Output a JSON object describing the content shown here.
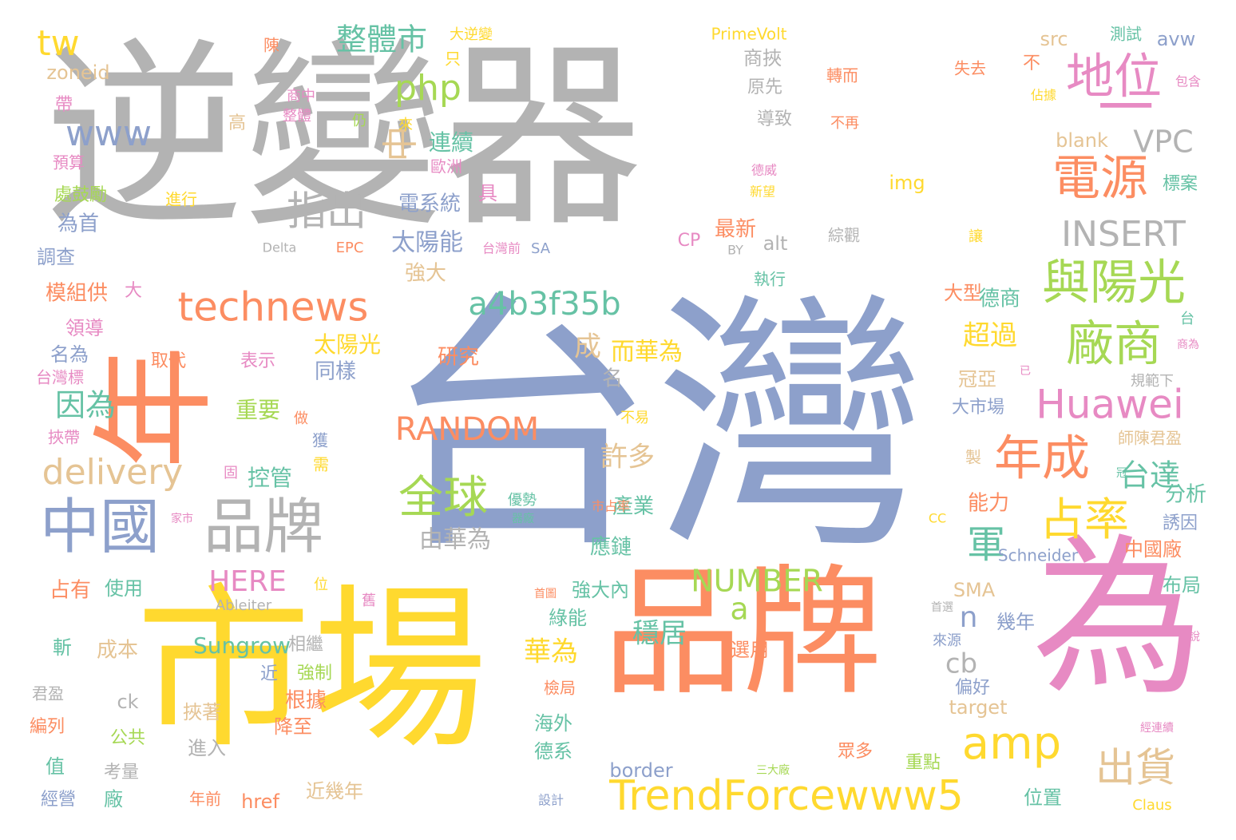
{
  "palette": {
    "gray": "#b3b3b3",
    "blue": "#8da0cb",
    "orange": "#fc8d62",
    "yellow": "#ffd92f",
    "pink": "#e78ac3",
    "green": "#a6d854",
    "teal": "#66c2a5",
    "tan": "#e5c494"
  },
  "words": [
    {
      "id": "w0",
      "text": "逆變器",
      "color": "gray"
    },
    {
      "id": "w1",
      "text": "台灣",
      "color": "blue"
    },
    {
      "id": "w2",
      "text": "市場",
      "color": "yellow"
    },
    {
      "id": "w3",
      "text": "品牌",
      "color": "orange"
    },
    {
      "id": "w4",
      "text": "為",
      "color": "pink"
    },
    {
      "id": "w5",
      "text": "年",
      "color": "orange"
    },
    {
      "id": "w6",
      "text": "一",
      "color": "pink"
    },
    {
      "id": "w7",
      "text": "中國",
      "color": "blue"
    },
    {
      "id": "w8",
      "text": "品牌",
      "color": "gray"
    },
    {
      "id": "w9",
      "text": "technews",
      "color": "orange"
    },
    {
      "id": "w10",
      "text": "TrendForcewww5",
      "color": "yellow"
    },
    {
      "id": "w11",
      "text": "Huawei",
      "color": "pink"
    },
    {
      "id": "w12",
      "text": "地位",
      "color": "pink"
    },
    {
      "id": "w13",
      "text": "廠商",
      "color": "green"
    },
    {
      "id": "w14",
      "text": "年成",
      "color": "orange"
    },
    {
      "id": "w15",
      "text": "電源",
      "color": "orange"
    },
    {
      "id": "w16",
      "text": "與陽光",
      "color": "green"
    },
    {
      "id": "w17",
      "text": "全球",
      "color": "green"
    },
    {
      "id": "w18",
      "text": "占率",
      "color": "yellow"
    },
    {
      "id": "w19",
      "text": "amp",
      "color": "yellow"
    },
    {
      "id": "w20",
      "text": "a4b3f35b",
      "color": "teal"
    },
    {
      "id": "w21",
      "text": "delivery",
      "color": "tan"
    },
    {
      "id": "w22",
      "text": "INSERT",
      "color": "gray"
    },
    {
      "id": "w23",
      "text": "RANDOM",
      "color": "orange"
    },
    {
      "id": "w24",
      "text": "NUMBER",
      "color": "green"
    },
    {
      "id": "w25",
      "text": "HERE",
      "color": "pink"
    },
    {
      "id": "w26",
      "text": "www",
      "color": "blue"
    },
    {
      "id": "w27",
      "text": "php",
      "color": "green"
    },
    {
      "id": "w28",
      "text": "tw",
      "color": "yellow"
    },
    {
      "id": "w29",
      "text": "整體市",
      "color": "teal"
    },
    {
      "id": "w30",
      "text": "指出",
      "color": "gray"
    },
    {
      "id": "w31",
      "text": "中",
      "color": "tan"
    },
    {
      "id": "w32",
      "text": "出貨",
      "color": "tan"
    },
    {
      "id": "w33",
      "text": "軍",
      "color": "teal"
    },
    {
      "id": "w34",
      "text": "台達",
      "color": "teal"
    },
    {
      "id": "w35",
      "text": "VPC",
      "color": "gray"
    },
    {
      "id": "w36",
      "text": "因為",
      "color": "teal"
    },
    {
      "id": "w37",
      "text": "a",
      "color": "green"
    },
    {
      "id": "w38",
      "text": "n",
      "color": "blue"
    },
    {
      "id": "w39",
      "text": "cb",
      "color": "gray"
    },
    {
      "id": "w40",
      "text": "超過",
      "color": "yellow"
    },
    {
      "id": "w41",
      "text": "穩居",
      "color": "teal"
    },
    {
      "id": "w42",
      "text": "華為",
      "color": "yellow"
    },
    {
      "id": "w43",
      "text": "許多",
      "color": "tan"
    },
    {
      "id": "w44",
      "text": "成",
      "color": "tan"
    },
    {
      "id": "w45",
      "text": "而華為",
      "color": "yellow"
    },
    {
      "id": "w46",
      "text": "由華為",
      "color": "gray"
    },
    {
      "id": "w47",
      "text": "Sungrow",
      "color": "teal"
    },
    {
      "id": "w48",
      "text": "zoneid",
      "color": "tan"
    },
    {
      "id": "w49",
      "text": "src",
      "color": "tan"
    },
    {
      "id": "w50",
      "text": "avw",
      "color": "blue"
    },
    {
      "id": "w51",
      "text": "PrimeVolt",
      "color": "yellow"
    },
    {
      "id": "w52",
      "text": "Schneider",
      "color": "blue"
    },
    {
      "id": "w53",
      "text": "Ableiter",
      "color": "gray"
    },
    {
      "id": "w54",
      "text": "Delta",
      "color": "gray"
    },
    {
      "id": "w55",
      "text": "EPC",
      "color": "orange"
    },
    {
      "id": "w56",
      "text": "SA",
      "color": "blue"
    },
    {
      "id": "w57",
      "text": "CP",
      "color": "pink"
    },
    {
      "id": "w58",
      "text": "BY",
      "color": "gray"
    },
    {
      "id": "w59",
      "text": "alt",
      "color": "gray"
    },
    {
      "id": "w60",
      "text": "img",
      "color": "yellow"
    },
    {
      "id": "w61",
      "text": "blank",
      "color": "tan"
    },
    {
      "id": "w62",
      "text": "SMA",
      "color": "tan"
    },
    {
      "id": "w63",
      "text": "CC",
      "color": "yellow"
    },
    {
      "id": "w64",
      "text": "target",
      "color": "tan"
    },
    {
      "id": "w65",
      "text": "border",
      "color": "blue"
    },
    {
      "id": "w66",
      "text": "href",
      "color": "orange"
    },
    {
      "id": "w67",
      "text": "ck",
      "color": "gray"
    },
    {
      "id": "w68",
      "text": "Claus",
      "color": "yellow"
    },
    {
      "id": "w69",
      "text": "太陽能",
      "color": "blue"
    },
    {
      "id": "w70",
      "text": "太陽光",
      "color": "yellow"
    },
    {
      "id": "w71",
      "text": "電系統",
      "color": "blue"
    },
    {
      "id": "w72",
      "text": "連續",
      "color": "teal"
    },
    {
      "id": "w73",
      "text": "歐洲",
      "color": "pink"
    },
    {
      "id": "w74",
      "text": "強大",
      "color": "tan"
    },
    {
      "id": "w75",
      "text": "最新",
      "color": "orange"
    },
    {
      "id": "w76",
      "text": "研究",
      "color": "orange"
    },
    {
      "id": "w77",
      "text": "同樣",
      "color": "blue"
    },
    {
      "id": "w78",
      "text": "控管",
      "color": "teal"
    },
    {
      "id": "w79",
      "text": "重要",
      "color": "green"
    },
    {
      "id": "w80",
      "text": "名",
      "color": "gray"
    },
    {
      "id": "w81",
      "text": "大型",
      "color": "orange"
    },
    {
      "id": "w82",
      "text": "德商",
      "color": "teal"
    },
    {
      "id": "w83",
      "text": "冠亞",
      "color": "tan"
    },
    {
      "id": "w84",
      "text": "大市場",
      "color": "blue"
    },
    {
      "id": "w85",
      "text": "分析",
      "color": "teal"
    },
    {
      "id": "w86",
      "text": "能力",
      "color": "orange"
    },
    {
      "id": "w87",
      "text": "產業",
      "color": "teal"
    },
    {
      "id": "w88",
      "text": "應鏈",
      "color": "teal"
    },
    {
      "id": "w89",
      "text": "中國廠",
      "color": "orange"
    },
    {
      "id": "w90",
      "text": "布局",
      "color": "teal"
    },
    {
      "id": "w91",
      "text": "誘因",
      "color": "blue"
    },
    {
      "id": "w92",
      "text": "占有",
      "color": "orange"
    },
    {
      "id": "w93",
      "text": "使用",
      "color": "teal"
    },
    {
      "id": "w94",
      "text": "強大內",
      "color": "teal"
    },
    {
      "id": "w95",
      "text": "綠能",
      "color": "teal"
    },
    {
      "id": "w96",
      "text": "幾年",
      "color": "blue"
    },
    {
      "id": "w97",
      "text": "成本",
      "color": "tan"
    },
    {
      "id": "w98",
      "text": "選用",
      "color": "orange"
    },
    {
      "id": "w99",
      "text": "偏好",
      "color": "blue"
    },
    {
      "id": "w100",
      "text": "根據",
      "color": "orange"
    },
    {
      "id": "w101",
      "text": "近",
      "color": "blue"
    },
    {
      "id": "w102",
      "text": "強制",
      "color": "green"
    },
    {
      "id": "w103",
      "text": "相繼",
      "color": "gray"
    },
    {
      "id": "w104",
      "text": "斬",
      "color": "teal"
    },
    {
      "id": "w105",
      "text": "挾著",
      "color": "tan"
    },
    {
      "id": "w106",
      "text": "降至",
      "color": "orange"
    },
    {
      "id": "w107",
      "text": "進入",
      "color": "gray"
    },
    {
      "id": "w108",
      "text": "海外",
      "color": "teal"
    },
    {
      "id": "w109",
      "text": "德系",
      "color": "teal"
    },
    {
      "id": "w110",
      "text": "眾多",
      "color": "orange"
    },
    {
      "id": "w111",
      "text": "重點",
      "color": "green"
    },
    {
      "id": "w112",
      "text": "位置",
      "color": "teal"
    },
    {
      "id": "w113",
      "text": "近幾年",
      "color": "tan"
    },
    {
      "id": "w114",
      "text": "廠",
      "color": "teal"
    },
    {
      "id": "w115",
      "text": "考量",
      "color": "gray"
    },
    {
      "id": "w116",
      "text": "公共",
      "color": "green"
    },
    {
      "id": "w117",
      "text": "編列",
      "color": "orange"
    },
    {
      "id": "w118",
      "text": "值",
      "color": "teal"
    },
    {
      "id": "w119",
      "text": "經營",
      "color": "blue"
    },
    {
      "id": "w120",
      "text": "年前",
      "color": "orange"
    },
    {
      "id": "w121",
      "text": "君盈",
      "color": "gray"
    },
    {
      "id": "w122",
      "text": "為首",
      "color": "blue"
    },
    {
      "id": "w123",
      "text": "調查",
      "color": "blue"
    },
    {
      "id": "w124",
      "text": "模組供",
      "color": "orange"
    },
    {
      "id": "w125",
      "text": "大",
      "color": "pink"
    },
    {
      "id": "w126",
      "text": "領導",
      "color": "pink"
    },
    {
      "id": "w127",
      "text": "名為",
      "color": "blue"
    },
    {
      "id": "w128",
      "text": "台灣標",
      "color": "pink"
    },
    {
      "id": "w129",
      "text": "取代",
      "color": "orange"
    },
    {
      "id": "w130",
      "text": "表示",
      "color": "pink"
    },
    {
      "id": "w131",
      "text": "挾帶",
      "color": "pink"
    },
    {
      "id": "w132",
      "text": "處鼓勵",
      "color": "green"
    },
    {
      "id": "w133",
      "text": "預算",
      "color": "pink"
    },
    {
      "id": "w134",
      "text": "帶",
      "color": "pink"
    },
    {
      "id": "w135",
      "text": "高",
      "color": "tan"
    },
    {
      "id": "w136",
      "text": "進行",
      "color": "yellow"
    },
    {
      "id": "w137",
      "text": "陳",
      "color": "orange"
    },
    {
      "id": "w138",
      "text": "商中",
      "color": "pink"
    },
    {
      "id": "w139",
      "text": "整體",
      "color": "pink"
    },
    {
      "id": "w140",
      "text": "仍",
      "color": "green"
    },
    {
      "id": "w141",
      "text": "來",
      "color": "yellow"
    },
    {
      "id": "w142",
      "text": "只",
      "color": "yellow"
    },
    {
      "id": "w143",
      "text": "大逆變",
      "color": "yellow"
    },
    {
      "id": "w144",
      "text": "具",
      "color": "pink"
    },
    {
      "id": "w145",
      "text": "商挾",
      "color": "gray"
    },
    {
      "id": "w146",
      "text": "原先",
      "color": "gray"
    },
    {
      "id": "w147",
      "text": "導致",
      "color": "gray"
    },
    {
      "id": "w148",
      "text": "不再",
      "color": "orange"
    },
    {
      "id": "w149",
      "text": "轉而",
      "color": "orange"
    },
    {
      "id": "w150",
      "text": "失去",
      "color": "orange"
    },
    {
      "id": "w151",
      "text": "不",
      "color": "orange"
    },
    {
      "id": "w152",
      "text": "測試",
      "color": "teal"
    },
    {
      "id": "w153",
      "text": "包含",
      "color": "pink"
    },
    {
      "id": "w154",
      "text": "佔據",
      "color": "yellow"
    },
    {
      "id": "w155",
      "text": "德威",
      "color": "pink"
    },
    {
      "id": "w156",
      "text": "新望",
      "color": "yellow"
    },
    {
      "id": "w157",
      "text": "綜觀",
      "color": "gray"
    },
    {
      "id": "w158",
      "text": "讓",
      "color": "yellow"
    },
    {
      "id": "w159",
      "text": "標案",
      "color": "teal"
    },
    {
      "id": "w160",
      "text": "執行",
      "color": "teal"
    },
    {
      "id": "w161",
      "text": "台灣前",
      "color": "pink"
    },
    {
      "id": "w162",
      "text": "台",
      "color": "teal"
    },
    {
      "id": "w163",
      "text": "商為",
      "color": "pink"
    },
    {
      "id": "w164",
      "text": "已",
      "color": "pink"
    },
    {
      "id": "w165",
      "text": "規範下",
      "color": "gray"
    },
    {
      "id": "w166",
      "text": "師陳君盈",
      "color": "tan"
    },
    {
      "id": "w167",
      "text": "製",
      "color": "tan"
    },
    {
      "id": "w168",
      "text": "冠",
      "color": "teal"
    },
    {
      "id": "w169",
      "text": "不易",
      "color": "yellow"
    },
    {
      "id": "w170",
      "text": "市占率",
      "color": "orange"
    },
    {
      "id": "w171",
      "text": "優勢",
      "color": "teal"
    },
    {
      "id": "w172",
      "text": "器廠",
      "color": "teal"
    },
    {
      "id": "w173",
      "text": "家市",
      "color": "pink"
    },
    {
      "id": "w174",
      "text": "需",
      "color": "yellow"
    },
    {
      "id": "w175",
      "text": "獲",
      "color": "blue"
    },
    {
      "id": "w176",
      "text": "做",
      "color": "orange"
    },
    {
      "id": "w177",
      "text": "固",
      "color": "pink"
    },
    {
      "id": "w178",
      "text": "位",
      "color": "yellow"
    },
    {
      "id": "w179",
      "text": "舊",
      "color": "pink"
    },
    {
      "id": "w180",
      "text": "首圖",
      "color": "orange"
    },
    {
      "id": "w181",
      "text": "首選",
      "color": "gray"
    },
    {
      "id": "w182",
      "text": "來源",
      "color": "blue"
    },
    {
      "id": "w183",
      "text": "說",
      "color": "pink"
    },
    {
      "id": "w184",
      "text": "檢局",
      "color": "orange"
    },
    {
      "id": "w185",
      "text": "經連續",
      "color": "pink"
    },
    {
      "id": "w186",
      "text": "三大廠",
      "color": "green"
    },
    {
      "id": "w187",
      "text": "設計",
      "color": "blue"
    }
  ]
}
